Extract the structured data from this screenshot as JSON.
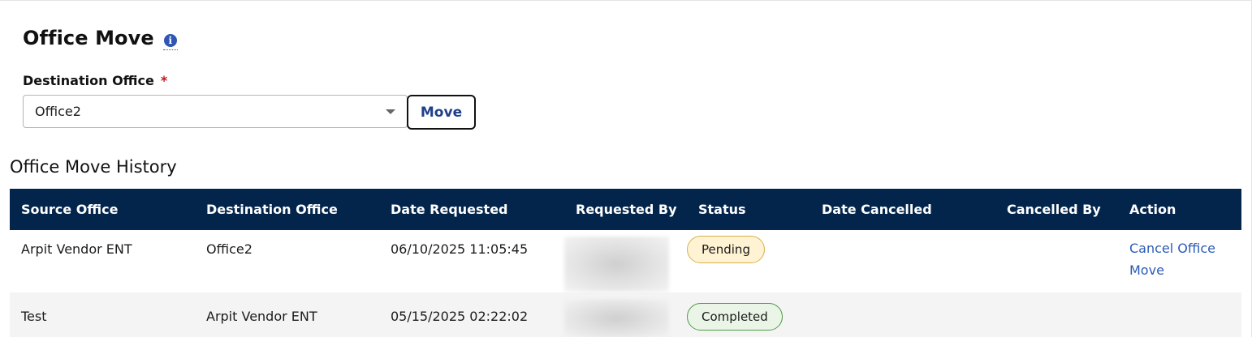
{
  "header": {
    "title": "Office Move",
    "info_icon": "i"
  },
  "form": {
    "label": "Destination Office",
    "required_marker": "*",
    "selected_value": "Office2",
    "move_label": "Move"
  },
  "history": {
    "title": "Office Move History",
    "columns": [
      "Source Office",
      "Destination Office",
      "Date Requested",
      "Requested By",
      "Status",
      "Date Cancelled",
      "Cancelled By",
      "Action"
    ],
    "rows": [
      {
        "source_office": "Arpit Vendor ENT",
        "destination_office": "Office2",
        "date_requested": "06/10/2025 11:05:45",
        "status": "Pending",
        "date_cancelled": "",
        "cancelled_by": "",
        "action": "Cancel Office Move"
      },
      {
        "source_office": "Test",
        "destination_office": "Arpit Vendor ENT",
        "date_requested": "05/15/2025 02:22:02",
        "status": "Completed",
        "date_cancelled": "",
        "cancelled_by": "",
        "action": ""
      }
    ]
  },
  "colors": {
    "header_bg": "#03254c",
    "link": "#2a5ab8",
    "required": "#c3161c",
    "pending_bg": "#fff3d4",
    "completed_bg": "#eaf5e8"
  }
}
